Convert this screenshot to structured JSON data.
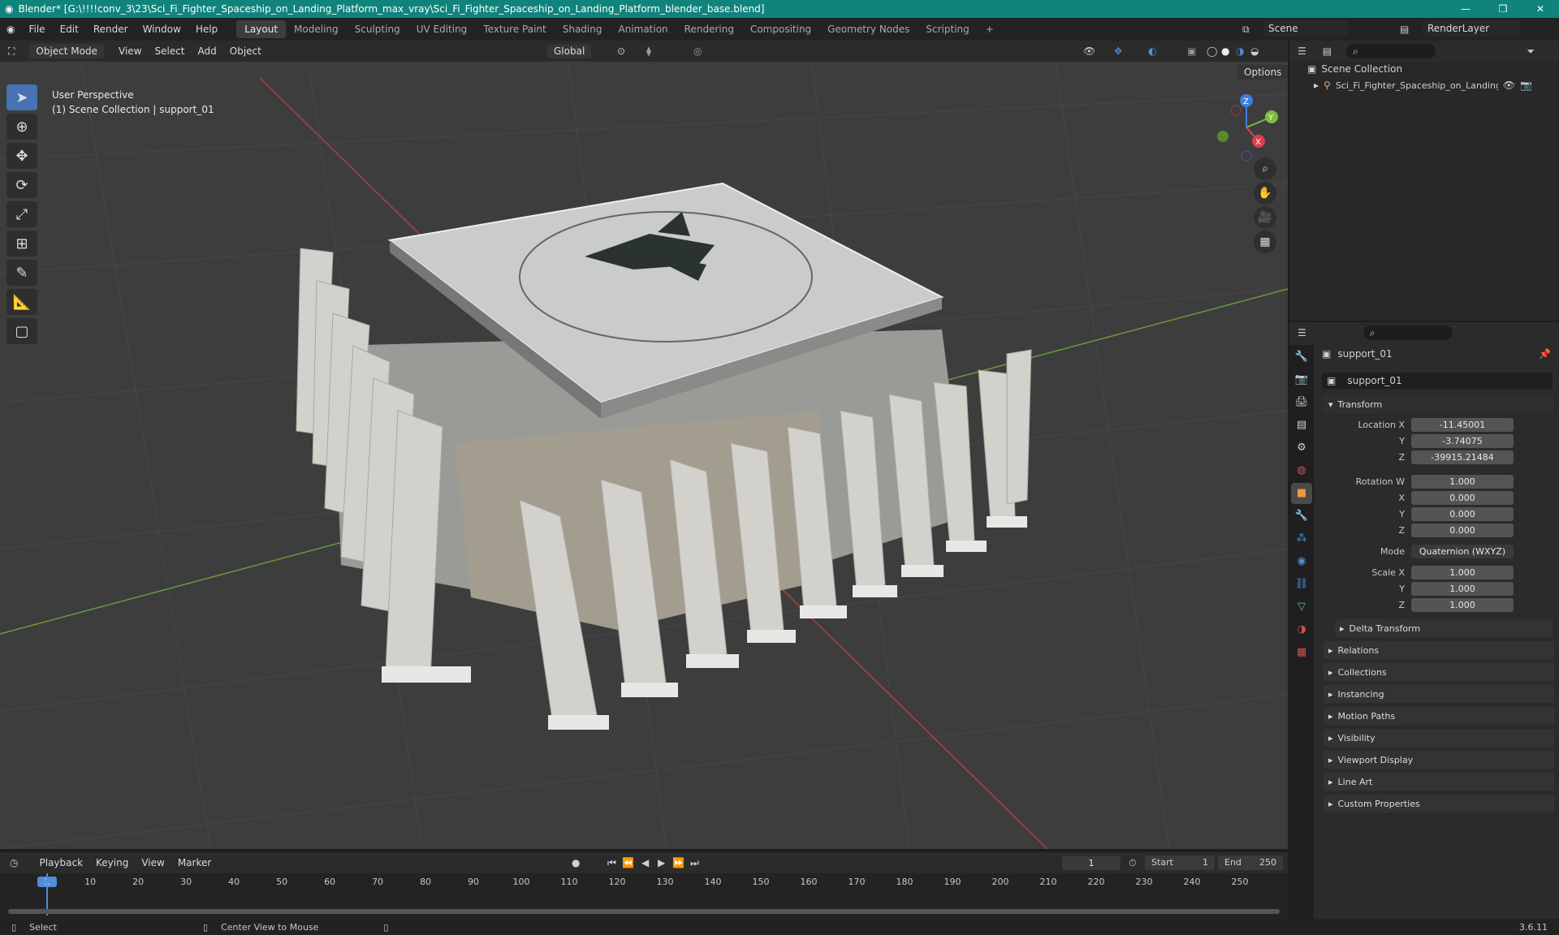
{
  "window": {
    "title": "Blender* [G:\\!!!!conv_3\\23\\Sci_Fi_Fighter_Spaceship_on_Landing_Platform_max_vray\\Sci_Fi_Fighter_Spaceship_on_Landing_Platform_blender_base.blend]",
    "minimize": "—",
    "maximize": "❐",
    "close": "✕"
  },
  "menu": [
    "File",
    "Edit",
    "Render",
    "Window",
    "Help"
  ],
  "workspaces": [
    "Layout",
    "Modeling",
    "Sculpting",
    "UV Editing",
    "Texture Paint",
    "Shading",
    "Animation",
    "Rendering",
    "Compositing",
    "Geometry Nodes",
    "Scripting",
    "+"
  ],
  "scene": {
    "label": "Scene",
    "render_layer": "RenderLayer"
  },
  "viewport_header": {
    "mode": "Object Mode",
    "menus": [
      "View",
      "Select",
      "Add",
      "Object"
    ],
    "orientation": "Global",
    "options": "Options"
  },
  "viewport": {
    "perspective": "User Perspective",
    "collection_info": "(1) Scene Collection | support_01",
    "gizmo": {
      "z": "Z",
      "y": "Y",
      "x": "X"
    }
  },
  "outliner": {
    "root": "Scene Collection",
    "item": "Sci_Fi_Fighter_Spaceship_on_Landing_P"
  },
  "properties": {
    "object_name": "support_01",
    "data_name": "support_01",
    "transform_label": "Transform",
    "location": {
      "label_x": "Location X",
      "label_y": "Y",
      "label_z": "Z",
      "x": "-11.45001",
      "y": "-3.74075",
      "z": "-39915.21484"
    },
    "rotation": {
      "label_w": "Rotation W",
      "label_x": "X",
      "label_y": "Y",
      "label_z": "Z",
      "w": "1.000",
      "x": "0.000",
      "y": "0.000",
      "z": "0.000"
    },
    "mode": {
      "label": "Mode",
      "value": "Quaternion (WXYZ)"
    },
    "scale": {
      "label_x": "Scale X",
      "label_y": "Y",
      "label_z": "Z",
      "x": "1.000",
      "y": "1.000",
      "z": "1.000"
    },
    "delta_transform": "Delta Transform",
    "panels": [
      "Relations",
      "Collections",
      "Instancing",
      "Motion Paths",
      "Visibility",
      "Viewport Display",
      "Line Art",
      "Custom Properties"
    ]
  },
  "timeline": {
    "menus": [
      "Playback",
      "Keying",
      "View",
      "Marker"
    ],
    "current_frame": "1",
    "start_label": "Start",
    "start": "1",
    "end_label": "End",
    "end": "250",
    "ticks": [
      "1",
      "10",
      "20",
      "30",
      "40",
      "50",
      "60",
      "70",
      "80",
      "90",
      "100",
      "110",
      "120",
      "130",
      "140",
      "150",
      "160",
      "170",
      "180",
      "190",
      "200",
      "210",
      "220",
      "230",
      "240",
      "250"
    ]
  },
  "status": {
    "select": "Select",
    "center_view": "Center View to Mouse",
    "version": "3.6.11"
  }
}
